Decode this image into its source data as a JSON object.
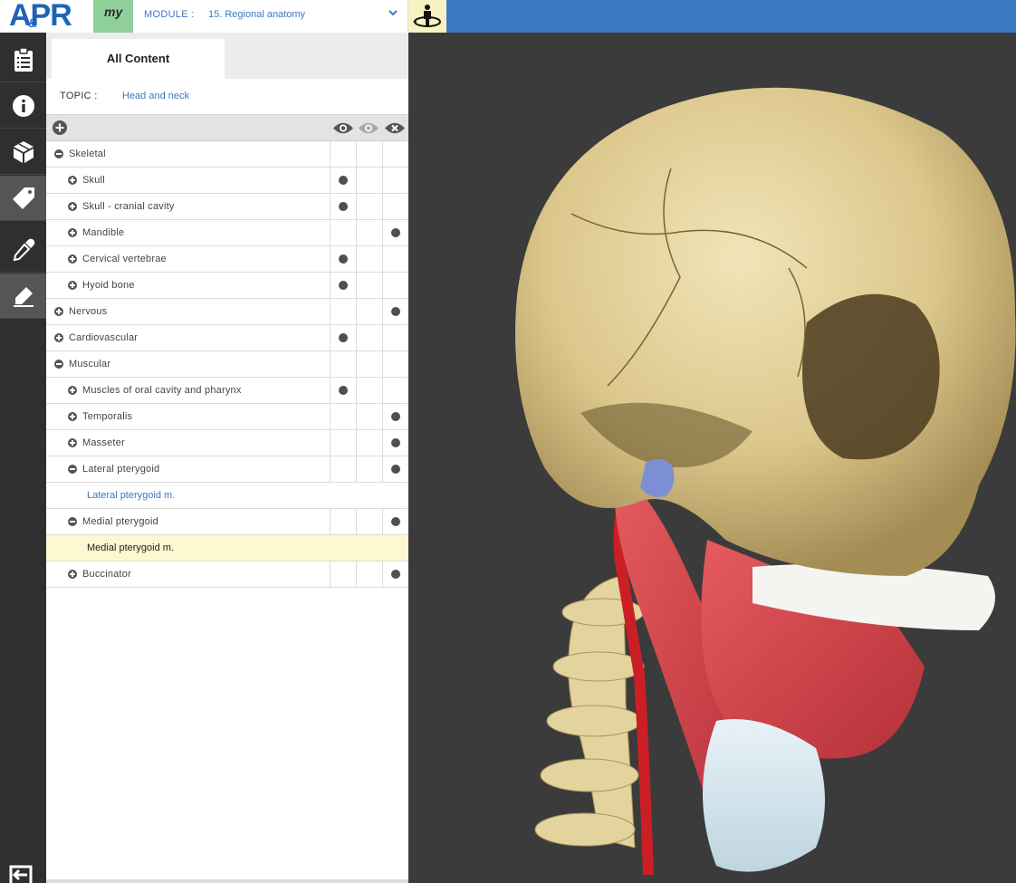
{
  "topbar": {
    "logo": "APR",
    "logo_amp": "&",
    "my_label": "my",
    "module_label": "MODULE  :",
    "module_value": "15. Regional anatomy"
  },
  "panel": {
    "tab_label": "All Content",
    "topic_label": "TOPIC  :",
    "topic_value": "Head and neck"
  },
  "tree": [
    {
      "label": "Skeletal",
      "level": 0,
      "toggle": "minus",
      "marks": [
        0,
        0,
        0
      ]
    },
    {
      "label": "Skull",
      "level": 1,
      "toggle": "plus",
      "marks": [
        1,
        0,
        0
      ]
    },
    {
      "label": "Skull - cranial cavity",
      "level": 1,
      "toggle": "plus",
      "marks": [
        1,
        0,
        0
      ]
    },
    {
      "label": "Mandible",
      "level": 1,
      "toggle": "plus",
      "marks": [
        0,
        0,
        1
      ]
    },
    {
      "label": "Cervical vertebrae",
      "level": 1,
      "toggle": "plus",
      "marks": [
        1,
        0,
        0
      ]
    },
    {
      "label": "Hyoid bone",
      "level": 1,
      "toggle": "plus",
      "marks": [
        1,
        0,
        0
      ]
    },
    {
      "label": "Nervous",
      "level": 0,
      "toggle": "plus",
      "marks": [
        0,
        0,
        1
      ]
    },
    {
      "label": "Cardiovascular",
      "level": 0,
      "toggle": "plus",
      "marks": [
        1,
        0,
        0
      ]
    },
    {
      "label": "Muscular",
      "level": 0,
      "toggle": "minus",
      "marks": [
        0,
        0,
        0
      ]
    },
    {
      "label": "Muscles of oral cavity and pharynx",
      "level": 1,
      "toggle": "plus",
      "marks": [
        1,
        0,
        0
      ]
    },
    {
      "label": "Temporalis",
      "level": 1,
      "toggle": "plus",
      "marks": [
        0,
        0,
        1
      ]
    },
    {
      "label": "Masseter",
      "level": 1,
      "toggle": "plus",
      "marks": [
        0,
        0,
        1
      ]
    },
    {
      "label": "Lateral pterygoid",
      "level": 1,
      "toggle": "minus",
      "marks": [
        0,
        0,
        1
      ]
    },
    {
      "label": "Lateral pterygoid m.",
      "level": 2,
      "leaf": true,
      "highlight": false,
      "color": "#3b78c2"
    },
    {
      "label": "Medial pterygoid",
      "level": 1,
      "toggle": "minus",
      "marks": [
        0,
        0,
        1
      ]
    },
    {
      "label": "Medial pterygoid m.",
      "level": 2,
      "leaf": true,
      "highlight": true,
      "color": "#222222"
    },
    {
      "label": "Buccinator",
      "level": 1,
      "toggle": "plus",
      "marks": [
        0,
        0,
        1
      ]
    }
  ],
  "icons": {
    "rail": [
      "clipboard-icon",
      "info-icon",
      "cube-icon",
      "tag-icon",
      "eyedropper-icon",
      "highlighter-icon",
      "exit-icon"
    ],
    "header": [
      "add-circle-icon",
      "eye-icon",
      "eye-faded-icon",
      "close-circle-icon"
    ]
  },
  "colors": {
    "topbar": "#3b78c2",
    "my_box": "#8fd09a",
    "person_box": "#f7f2c2",
    "highlight_row": "#fdf8cf",
    "link": "#3b78c2"
  }
}
